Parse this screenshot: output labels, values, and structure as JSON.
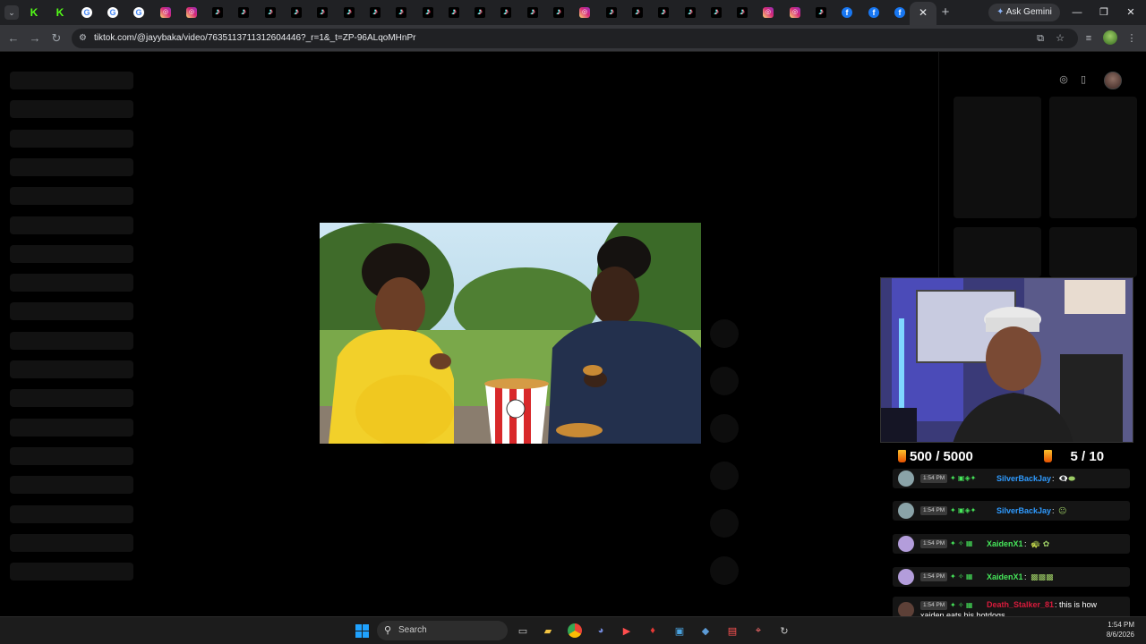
{
  "browser": {
    "tabs": [
      {
        "icon": "kick-icon",
        "glyph": "K",
        "cls": "fav-k"
      },
      {
        "icon": "kick-icon",
        "glyph": "K",
        "cls": "fav-k"
      },
      {
        "icon": "google-icon",
        "glyph": "G",
        "cls": "fav-g"
      },
      {
        "icon": "google-icon",
        "glyph": "G",
        "cls": "fav-g"
      },
      {
        "icon": "google-icon",
        "glyph": "G",
        "cls": "fav-g"
      },
      {
        "icon": "instagram-icon",
        "glyph": "◎",
        "cls": "fav-ig"
      },
      {
        "icon": "instagram-icon",
        "glyph": "◎",
        "cls": "fav-ig"
      },
      {
        "icon": "tiktok-icon",
        "glyph": "♪",
        "cls": "fav-tt"
      },
      {
        "icon": "tiktok-icon",
        "glyph": "♪",
        "cls": "fav-tt"
      },
      {
        "icon": "tiktok-icon",
        "glyph": "♪",
        "cls": "fav-tt"
      },
      {
        "icon": "tiktok-icon",
        "glyph": "♪",
        "cls": "fav-tt"
      },
      {
        "icon": "tiktok-icon",
        "glyph": "♪",
        "cls": "fav-tt"
      },
      {
        "icon": "tiktok-icon",
        "glyph": "♪",
        "cls": "fav-tt"
      },
      {
        "icon": "tiktok-icon",
        "glyph": "♪",
        "cls": "fav-tt"
      },
      {
        "icon": "tiktok-icon",
        "glyph": "♪",
        "cls": "fav-tt"
      },
      {
        "icon": "tiktok-icon",
        "glyph": "♪",
        "cls": "fav-tt"
      },
      {
        "icon": "tiktok-icon",
        "glyph": "♪",
        "cls": "fav-tt"
      },
      {
        "icon": "tiktok-icon",
        "glyph": "♪",
        "cls": "fav-tt"
      },
      {
        "icon": "tiktok-icon",
        "glyph": "♪",
        "cls": "fav-tt"
      },
      {
        "icon": "tiktok-icon",
        "glyph": "♪",
        "cls": "fav-tt"
      },
      {
        "icon": "tiktok-icon",
        "glyph": "♪",
        "cls": "fav-tt"
      },
      {
        "icon": "instagram-icon",
        "glyph": "◎",
        "cls": "fav-ig"
      },
      {
        "icon": "tiktok-icon",
        "glyph": "♪",
        "cls": "fav-tt"
      },
      {
        "icon": "tiktok-icon",
        "glyph": "♪",
        "cls": "fav-tt"
      },
      {
        "icon": "tiktok-icon",
        "glyph": "♪",
        "cls": "fav-tt"
      },
      {
        "icon": "tiktok-icon",
        "glyph": "♪",
        "cls": "fav-tt"
      },
      {
        "icon": "tiktok-icon",
        "glyph": "♪",
        "cls": "fav-tt"
      },
      {
        "icon": "tiktok-icon",
        "glyph": "♪",
        "cls": "fav-tt"
      },
      {
        "icon": "instagram-icon",
        "glyph": "◎",
        "cls": "fav-ig"
      },
      {
        "icon": "instagram-icon",
        "glyph": "◎",
        "cls": "fav-ig"
      },
      {
        "icon": "tiktok-icon",
        "glyph": "♪",
        "cls": "fav-tt"
      },
      {
        "icon": "facebook-icon",
        "glyph": "f",
        "cls": "fav-fb"
      },
      {
        "icon": "facebook-icon",
        "glyph": "f",
        "cls": "fav-fb"
      },
      {
        "icon": "facebook-icon",
        "glyph": "f",
        "cls": "fav-fb"
      },
      {
        "icon": "youtube-icon",
        "glyph": "▶",
        "cls": "fav-yt"
      }
    ],
    "active_tab_close": "✕",
    "new_tab": "+",
    "gemini_label": "Ask Gemini",
    "url": "tiktok.com/@jayybaka/video/7635113711312604446?_r=1&_t=ZP-96ALqoMHnPr"
  },
  "stream": {
    "counter_left": "500 / 5000",
    "counter_right": "5 / 10"
  },
  "chat": [
    {
      "time": "1:54 PM",
      "user": "SilverBackJay",
      "user_color": "#2f9bff",
      "badges": "✦ ▣◈✦",
      "badge_color": "#46e65a",
      "text": "",
      "emotes": "👁‍🗨⬬",
      "avatar": "#8aa3a8"
    },
    {
      "time": "1:54 PM",
      "user": "SilverBackJay",
      "user_color": "#2f9bff",
      "badges": "✦ ▣◈✦",
      "badge_color": "#46e65a",
      "text": "",
      "emotes": "😐",
      "avatar": "#8aa3a8"
    },
    {
      "time": "1:54 PM",
      "user": "XaidenX1",
      "user_color": "#46e65a",
      "badges": "✦ ✧ ▦",
      "badge_color": "#46e65a",
      "text": "",
      "emotes": "🐢 ✿",
      "avatar": "#b39ddb"
    },
    {
      "time": "1:54 PM",
      "user": "XaidenX1",
      "user_color": "#46e65a",
      "badges": "✦ ✧ ▦",
      "badge_color": "#46e65a",
      "text": "",
      "emotes": "▩▩▩",
      "avatar": "#b39ddb"
    },
    {
      "time": "1:54 PM",
      "user": "Death_Stalker_81",
      "user_color": "#d81b3c",
      "badges": "✦ ✧ ▦",
      "badge_color": "#46e65a",
      "text": "this is how",
      "text2": "xaiden eats his hotdogs",
      "emotes": "",
      "avatar": "#5d4037"
    }
  ],
  "taskbar": {
    "search_placeholder": "Search",
    "time": "1:54 PM",
    "date": "8/6/2026"
  },
  "colors": {
    "chrome_dark": "#202124",
    "toolbar": "#35363a",
    "kick_green": "#53fc18"
  }
}
